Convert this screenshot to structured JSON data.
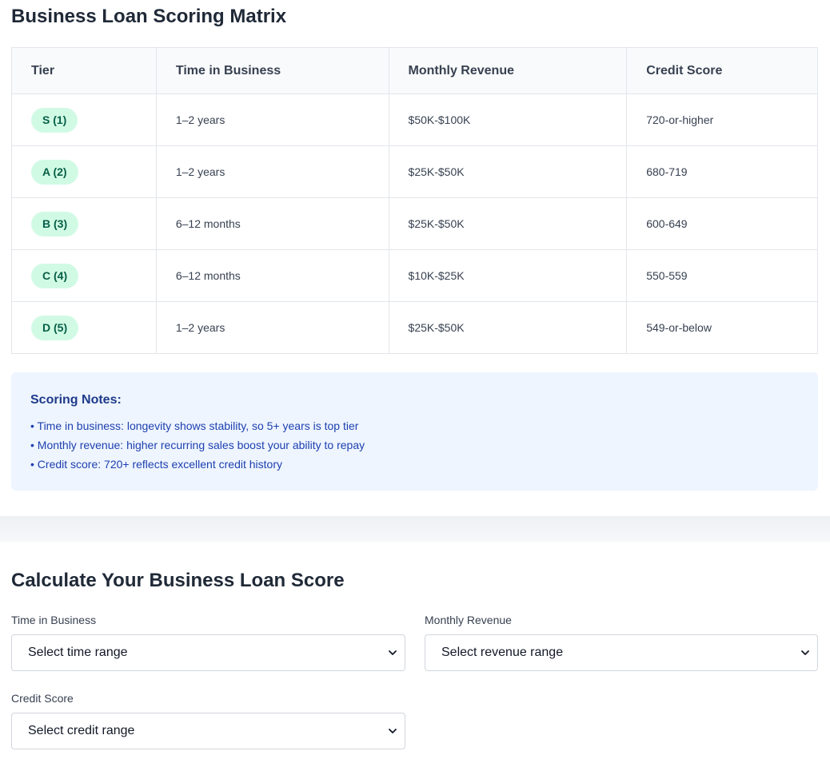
{
  "matrix": {
    "title": "Business Loan Scoring Matrix",
    "headers": [
      "Tier",
      "Time in Business",
      "Monthly Revenue",
      "Credit Score"
    ],
    "rows": [
      {
        "tier": "S (1)",
        "time": "1–2 years",
        "revenue": "$50K-$100K",
        "credit": "720-or-higher"
      },
      {
        "tier": "A (2)",
        "time": "1–2 years",
        "revenue": "$25K-$50K",
        "credit": "680-719"
      },
      {
        "tier": "B (3)",
        "time": "6–12 months",
        "revenue": "$25K-$50K",
        "credit": "600-649"
      },
      {
        "tier": "C (4)",
        "time": "6–12 months",
        "revenue": "$10K-$25K",
        "credit": "550-559"
      },
      {
        "tier": "D (5)",
        "time": "1–2 years",
        "revenue": "$25K-$50K",
        "credit": "549-or-below"
      }
    ]
  },
  "notes": {
    "title": "Scoring Notes:",
    "items": [
      "• Time in business: longevity shows stability, so 5+ years is top tier",
      "• Monthly revenue: higher recurring sales boost your ability to repay",
      "• Credit score: 720+ reflects excellent credit history"
    ]
  },
  "calculator": {
    "title": "Calculate Your Business Loan Score",
    "time_label": "Time in Business",
    "time_value": "Select time range",
    "revenue_label": "Monthly Revenue",
    "revenue_value": "Select revenue range",
    "credit_label": "Credit Score",
    "credit_value": "Select credit range"
  },
  "colors": {
    "badge_bg": "#d1fae5",
    "badge_text": "#065f46",
    "notes_bg": "#eef5ff",
    "notes_text": "#1e40af"
  }
}
